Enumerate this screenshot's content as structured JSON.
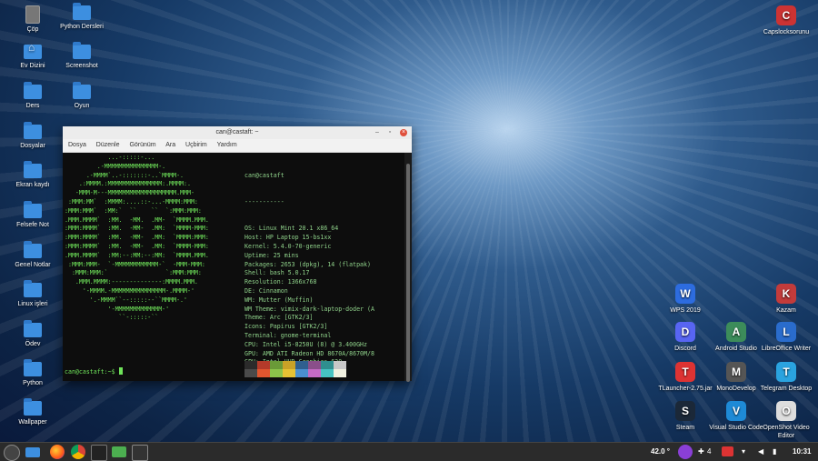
{
  "desktop": {
    "left_col1": [
      "Çöp",
      "Ev Dizini",
      "Ders",
      "Dosyalar",
      "Ekran kaydı",
      "Felsefe Not",
      "Genel Notlar",
      "Linux işleri",
      "Ödev",
      "Python",
      "Wallpaper"
    ],
    "left_col2": [
      "Python Dersleri",
      "Screenshot",
      "Oyun"
    ],
    "right_top": "Capslocksorunu",
    "right_apps": [
      {
        "label": "WPS 2019",
        "color": "#2d6cdf"
      },
      {
        "label": "Kazam",
        "color": "#c23b3b"
      },
      {
        "label": "Discord",
        "color": "#5865f2"
      },
      {
        "label": "Android Studio",
        "color": "#3c8c5a"
      },
      {
        "label": "LibreOffice Writer",
        "color": "#2a6ccc"
      },
      {
        "label": "TLauncher-2.75.jar",
        "color": "#d33"
      },
      {
        "label": "MonoDevelop",
        "color": "#555"
      },
      {
        "label": "Telegram Desktop",
        "color": "#2aa3df"
      },
      {
        "label": "Steam",
        "color": "#1b2838"
      },
      {
        "label": "Visual Studio Code",
        "color": "#1e8ad6"
      },
      {
        "label": "OpenShot Video Editor",
        "color": "#ddd"
      }
    ]
  },
  "terminal": {
    "title": "can@castaft: ~",
    "menu": [
      "Dosya",
      "Düzenle",
      "Görünüm",
      "Ara",
      "Uçbirim",
      "Yardım"
    ],
    "ascii": "            ...-:::::-...\n         .-MMMMMMMMMMMMMMM-.\n      .-MMMM`..-:::::::-..`MMMM-.\n    .:MMMM.:MMMMMMMMMMMMMMM:.MMMM:.\n   -MMM-M---MMMMMMMMMMMMMMMMMMM.MMM-\n :MMM:MM`  :MMMM:....::-...-MMMM:MMM:\n:MMM:MMM`  :MM:`  ``    ``  `:MMM:MMM:\n.MMM.MMMM`  :MM.  -MM.  .MM-  `MMMM.MMM.\n:MMM:MMMM`  :MM.  -MM-  .MM:  `MMMM-MMM:\n:MMM:MMMM`  :MM.  -MM-  .MM:  `MMMM:MMM:\n:MMM:MMMM`  :MM.  -MM-  .MM:  `MMMM-MMM:\n.MMM.MMMM`  :MM:--:MM:--:MM:  `MMMM.MMM.\n :MMM:MMM-  `-MMMMMMMMMMMM-`  -MMM-MMM:\n  :MMM:MMM:`                `:MMM:MMM:\n   .MMM.MMMM:--------------:MMMM.MMM.\n     '-MMMM.-MMMMMMMMMMMMMMM-.MMMM-'\n       '.-MMMM``--:::::--``MMMM-.'\n            '-MMMMMMMMMMMMM-'\n               ``-:::::-``",
    "user_host": "can@castaft",
    "separator": "-----------",
    "info": [
      {
        "k": "OS",
        "v": "Linux Mint 20.1 x86_64"
      },
      {
        "k": "Host",
        "v": "HP Laptop 15-bs1xx"
      },
      {
        "k": "Kernel",
        "v": "5.4.0-70-generic"
      },
      {
        "k": "Uptime",
        "v": "25 mins"
      },
      {
        "k": "Packages",
        "v": "2653 (dpkg), 14 (flatpak)"
      },
      {
        "k": "Shell",
        "v": "bash 5.0.17"
      },
      {
        "k": "Resolution",
        "v": "1366x768"
      },
      {
        "k": "DE",
        "v": "Cinnamon"
      },
      {
        "k": "WM",
        "v": "Mutter (Muffin)"
      },
      {
        "k": "WM Theme",
        "v": "vimix-dark-laptop-doder (A"
      },
      {
        "k": "Theme",
        "v": "Arc [GTK2/3]"
      },
      {
        "k": "Icons",
        "v": "Papirus [GTK2/3]"
      },
      {
        "k": "Terminal",
        "v": "gnome-terminal"
      },
      {
        "k": "CPU",
        "v": "Intel i5-8250U (8) @ 3.400GHz"
      },
      {
        "k": "GPU",
        "v": "AMD ATI Radeon HD 8670A/8670M/8"
      },
      {
        "k": "GPU",
        "v": "Intel UHD Graphics 620"
      },
      {
        "k": "Memory",
        "v": "2065MiB / 7877MiB"
      }
    ],
    "palette_row1": [
      "#2b2b2b",
      "#b43a2a",
      "#6a9a38",
      "#c9a227",
      "#2f5f8f",
      "#8a4f8a",
      "#2f8f8f",
      "#c8c8c8"
    ],
    "palette_row2": [
      "#4a4a4a",
      "#e0562f",
      "#8cc34a",
      "#e6c234",
      "#4a8fd0",
      "#c46bc4",
      "#46c2c2",
      "#f0f0e0"
    ],
    "prompt": "can@castaft:~$ "
  },
  "taskbar": {
    "temperature": "42.0 °",
    "notif_count": "4",
    "clock": "10:31",
    "pinned": [
      "menu-icon",
      "files-icon",
      "firefox-icon",
      "chrome-icon",
      "terminal-icon",
      "folder-icon",
      "terminal2-icon"
    ]
  }
}
